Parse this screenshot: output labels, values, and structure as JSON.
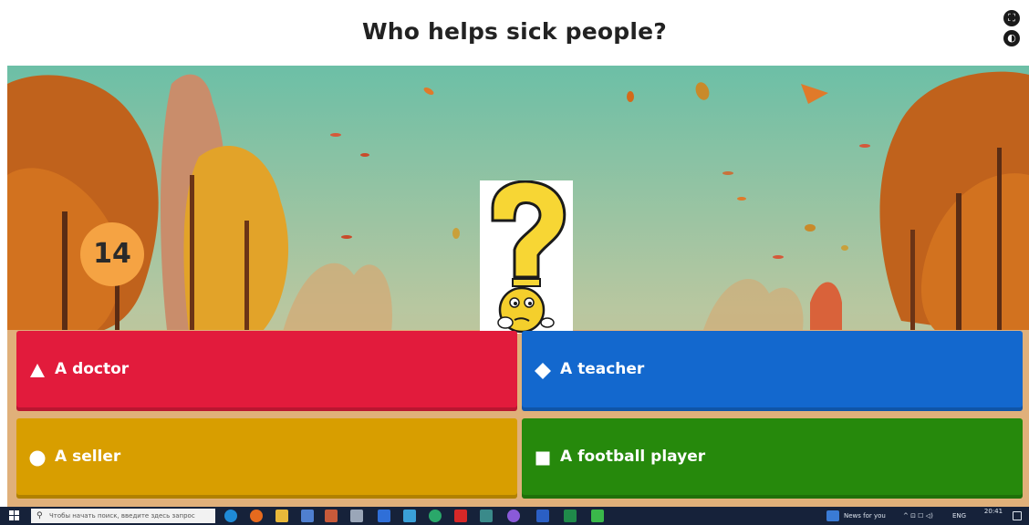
{
  "header": {
    "question": "Who helps sick people?",
    "fullscreen_icon": "fullscreen-icon",
    "sound_icon": "sound-icon"
  },
  "game": {
    "timer": "14",
    "image_icon": "thinking-question-mark-icon",
    "answers": [
      {
        "shape": "triangle",
        "text": "A doctor",
        "color": "#e21b3c"
      },
      {
        "shape": "diamond",
        "text": "A teacher",
        "color": "#1368ce"
      },
      {
        "shape": "circle",
        "text": "A seller",
        "color": "#d89e00"
      },
      {
        "shape": "square",
        "text": "A football player",
        "color": "#26890c"
      }
    ]
  },
  "taskbar": {
    "search_placeholder": "Чтобы начать поиск, введите здесь запрос",
    "news": "News for you",
    "language": "ENG",
    "time": "20:41"
  }
}
